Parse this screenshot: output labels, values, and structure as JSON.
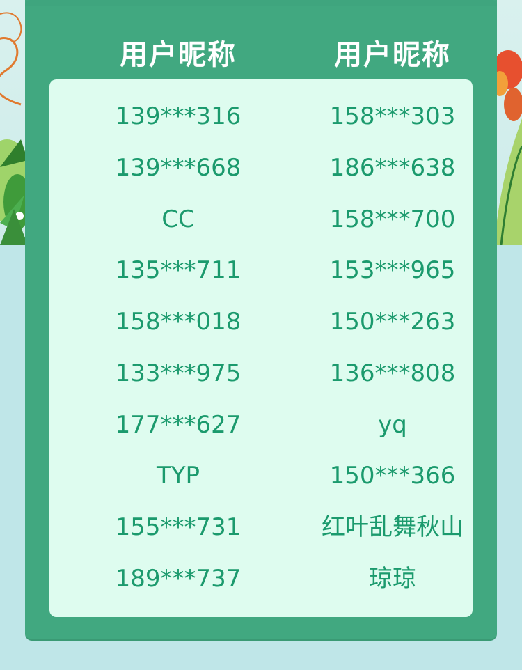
{
  "table": {
    "headers": [
      "用户昵称",
      "用户昵称"
    ],
    "rows": [
      [
        "139***316",
        "158***303"
      ],
      [
        "139***668",
        "186***638"
      ],
      [
        "CC",
        "158***700"
      ],
      [
        "135***711",
        "153***965"
      ],
      [
        "158***018",
        "150***263"
      ],
      [
        "133***975",
        "136***808"
      ],
      [
        "177***627",
        "yq"
      ],
      [
        "TYP",
        "150***366"
      ],
      [
        "155***731",
        "红叶乱舞秋山"
      ],
      [
        "189***737",
        "琼琼"
      ]
    ]
  },
  "colors": {
    "panel": "#41a880",
    "card": "#defcef",
    "text": "#1b9a6d",
    "header_text": "#ffffff",
    "background": "#bfe6e8"
  },
  "decorations": {
    "left": "leaf-and-ribbon-decoration",
    "right": "flower-decoration"
  }
}
